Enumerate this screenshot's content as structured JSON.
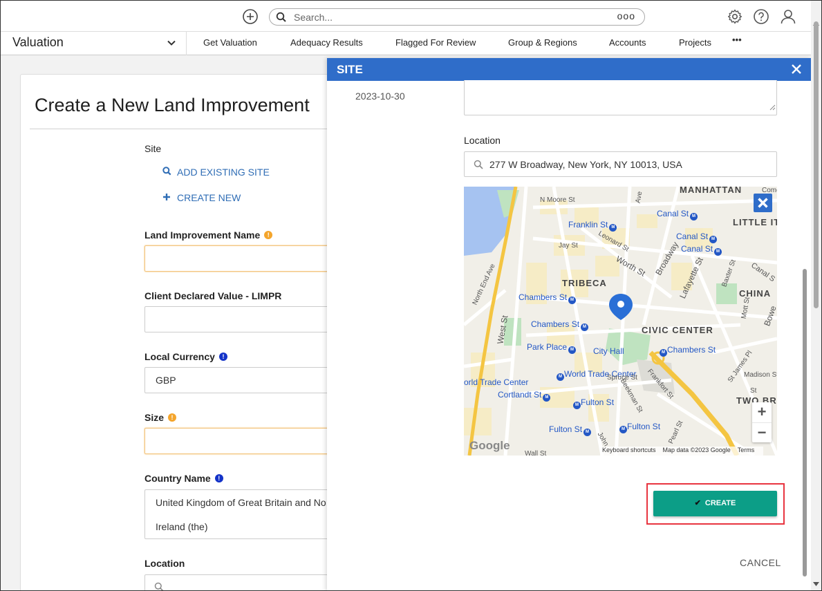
{
  "topbar": {
    "search_placeholder": "Search...",
    "search_more": "ooo",
    "icons": [
      "add-circle-icon",
      "search-icon",
      "gear-icon",
      "help-icon",
      "user-icon"
    ]
  },
  "navbar": {
    "module": "Valuation",
    "links": [
      "Get Valuation",
      "Adequacy Results",
      "Flagged For Review",
      "Group & Regions",
      "Accounts",
      "Projects"
    ],
    "more": "•••"
  },
  "form": {
    "title": "Create a New Land Improvement",
    "site_label": "Site",
    "add_existing_site": "ADD EXISTING SITE",
    "create_new": "CREATE NEW",
    "land_improvement_name_label": "Land Improvement Name",
    "client_declared_value_label": "Client Declared Value - LIMPR",
    "local_currency_label": "Local Currency",
    "local_currency_value": "GBP",
    "size_label": "Size",
    "country_name_label": "Country Name",
    "country_name_line1": "United Kingdom of Great Britain and No",
    "country_name_line2": "Ireland (the)",
    "location_label": "Location"
  },
  "modal": {
    "title": "SITE",
    "date": "2023-10-30",
    "location_label": "Location",
    "location_value": "277 W Broadway, New York, NY 10013, USA",
    "create_label": "CREATE",
    "cancel_label": "CANCEL",
    "map": {
      "labels": {
        "manhattan": "MANHATTAN",
        "little_italy": "LITTLE IT",
        "tribeca": "TRIBECA",
        "chinatown": "CHINA",
        "civic_center": "CIVIC CENTER",
        "two_bridges": "TWO BR",
        "canal_st_1": "Canal St",
        "canal_st_2": "Canal St",
        "canal_st_3": "Canal St",
        "canal_st_right": "Canal S",
        "franklin_st": "Franklin St",
        "chambers_st_1": "Chambers St",
        "chambers_st_2": "Chambers St",
        "chambers_st_3": "Chambers St",
        "park_place": "Park Place",
        "city_hall": "City Hall",
        "world_trade_center": "World Trade Center",
        "world_trade_center_path": "orld Trade Center",
        "cortlandt_st": "Cortlandt St",
        "fulton_st_1": "Fulton St",
        "fulton_st_2": "Fulton St",
        "fulton_st_3": "Fulton St",
        "n_moore_st": "N Moore St",
        "jay_st": "Jay St",
        "leonard_st": "Leonard St",
        "worth_st": "Worth St",
        "broadway": "Broadway",
        "lafayette_st": "Lafayette St",
        "north_end_ave": "North End Ave",
        "west_st": "West St",
        "mott_st": "Mott St",
        "baxter_st": "Baxter St",
        "bowery": "Bowe",
        "st_james_pl": "St James Pl",
        "madison_st": "Madison St",
        "frankfort_st": "Frankfort St",
        "spruce_st": "Spruce St",
        "beekman_st": "Beekman St",
        "john_st": "John",
        "pearl_st": "Pearl St",
        "wall_st": "Wall St",
        "ave": "Ave",
        "st_short": "St",
        "comer": "Come"
      },
      "google": "Google",
      "keyboard_shortcuts": "Keyboard shortcuts",
      "map_data": "Map data ©2023 Google",
      "terms": "Terms",
      "zoom_in": "+",
      "zoom_out": "−"
    }
  },
  "colors": {
    "accent_blue": "#2f6dc9",
    "create_green": "#0c9e87",
    "required_orange": "#f4a52c",
    "info_blue": "#1433c8",
    "highlight_red": "#e8343f"
  }
}
